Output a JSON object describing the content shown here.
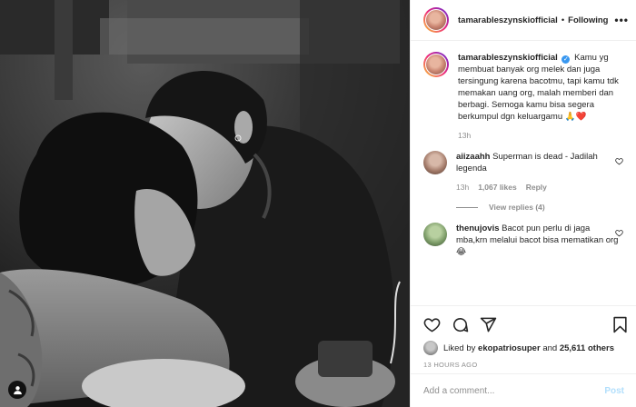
{
  "header": {
    "username": "tamarableszynskiofficial",
    "separator": "•",
    "follow_status": "Following",
    "more_label": "•••"
  },
  "caption": {
    "username": "tamarableszynskiofficial",
    "verified_mark": "✓",
    "text": "Kamu yg membuat banyak org melek dan juga tersingung karena bacotmu, tapi kamu tdk memakan uang org, malah memberi dan berbagi. Semoga kamu bisa segera berkumpul dgn keluargamu 🙏❤️",
    "time": "13h"
  },
  "comments": [
    {
      "username": "aiizaahh",
      "text": "Superman is dead - Jadilah legenda",
      "time": "13h",
      "likes": "1,067 likes",
      "reply_label": "Reply",
      "view_replies": "View replies (4)"
    },
    {
      "username": "thenujovis",
      "text": "Bacot pun perlu di jaga mba,krn melalui bacot bisa mematikan org 😂"
    }
  ],
  "actions": {
    "like_icon": "heart-icon",
    "comment_icon": "comment-icon",
    "share_icon": "share-icon",
    "save_icon": "bookmark-icon"
  },
  "likes": {
    "prefix": "Liked by",
    "user": "ekopatriosuper",
    "and": "and",
    "others": "25,611 others"
  },
  "time_ago": "13 HOURS AGO",
  "add_comment": {
    "placeholder": "Add a comment...",
    "post_label": "Post"
  },
  "colors": {
    "accent_link": "#3897f0",
    "post_disabled": "#b2dffc",
    "muted_text": "#8e8e8e",
    "heart_red": "#ed4956"
  }
}
